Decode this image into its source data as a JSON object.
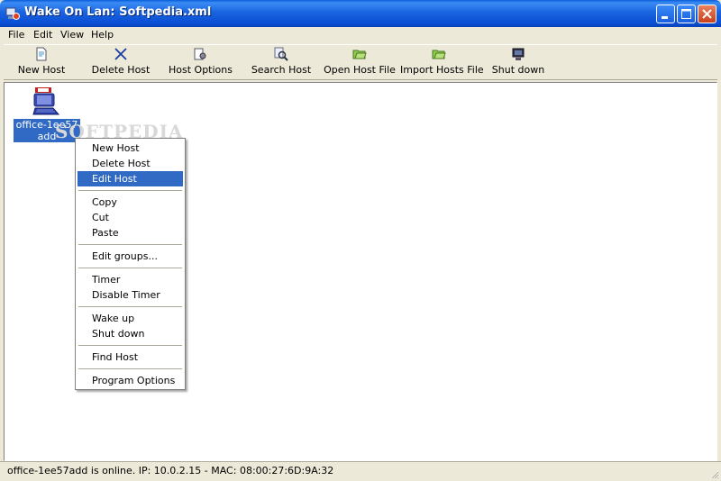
{
  "window": {
    "title": "Wake On Lan: Softpedia.xml"
  },
  "menu": [
    "File",
    "Edit",
    "View",
    "Help"
  ],
  "toolbar": [
    {
      "label": "New Host",
      "icon": "new-host-icon"
    },
    {
      "label": "Delete Host",
      "icon": "delete-host-icon"
    },
    {
      "label": "Host Options",
      "icon": "host-options-icon"
    },
    {
      "label": "Search Host",
      "icon": "search-host-icon"
    },
    {
      "label": "Open Host File",
      "icon": "open-folder-icon"
    },
    {
      "label": "Import Hosts File",
      "icon": "import-folder-icon"
    },
    {
      "label": "Shut down",
      "icon": "shutdown-icon"
    }
  ],
  "host": {
    "label": "office-1ee57add"
  },
  "watermark": "SOFTPEDIA",
  "context_menu": {
    "items": [
      "New Host",
      "Delete Host",
      "Edit Host",
      "Copy",
      "Cut",
      "Paste",
      "Edit groups...",
      "Timer",
      "Disable Timer",
      "Wake up",
      "Shut down",
      "Find Host",
      "Program Options"
    ],
    "selected": "Edit Host"
  },
  "status": {
    "text": "office-1ee57add is online. IP: 10.0.2.15 - MAC: 08:00:27:6D:9A:32"
  },
  "colors": {
    "titlebar": "#0b4fd4",
    "selection": "#316ac5",
    "face": "#ece9d8",
    "close_button": "#c8401c"
  }
}
